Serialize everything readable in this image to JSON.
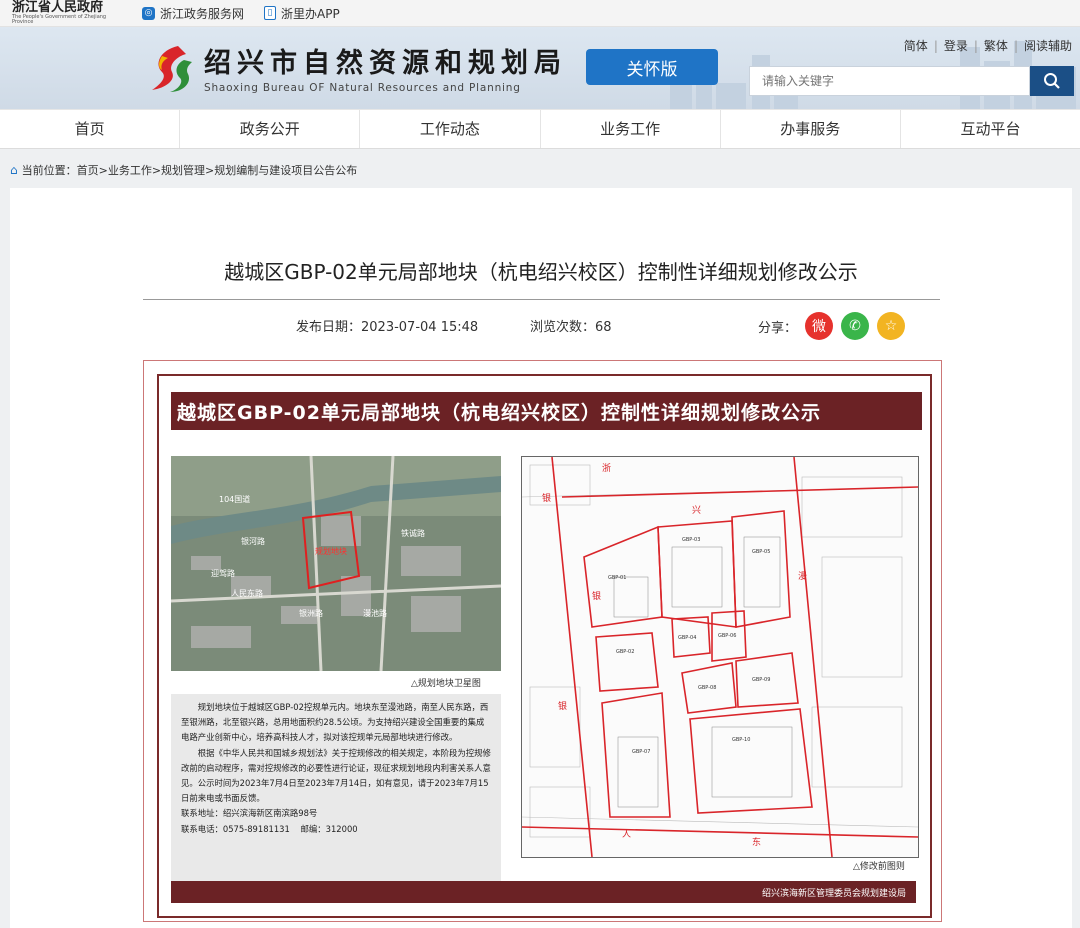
{
  "topbar": {
    "gov_name": "浙江省人民政府",
    "gov_name_en": "The People's Government of Zhejiang Province",
    "link1": "浙江政务服务网",
    "link2": "浙里办APP"
  },
  "header": {
    "site_title": "绍兴市自然资源和规划局",
    "site_title_en": "Shaoxing Bureau OF Natural Resources and Planning",
    "care_button": "关怀版",
    "tool_links": [
      "简体",
      "登录",
      "繁体",
      "阅读辅助"
    ],
    "search_placeholder": "请输入关键字"
  },
  "nav": [
    "首页",
    "政务公开",
    "工作动态",
    "业务工作",
    "办事服务",
    "互动平台"
  ],
  "breadcrumb": {
    "label": "当前位置：",
    "path": "首页>业务工作>规划管理>规划编制与建设项目公告公布"
  },
  "article": {
    "title": "越城区GBP-02单元局部地块（杭电绍兴校区）控制性详细规划修改公示",
    "publish_label": "发布日期：",
    "publish_date": "2023-07-04 15:48",
    "views_label": "浏览次数：",
    "views": "68",
    "share_label": "分享："
  },
  "poster": {
    "title": "越城区GBP-02单元局部地块（杭电绍兴校区）控制性详细规划修改公示",
    "sat_caption": "△规划地块卫星图",
    "map_caption": "△修改前图则",
    "sat_labels": {
      "road1": "104国道",
      "river": "银河路",
      "block": "规划地块",
      "road_e": "铁诚路",
      "road_w": "迎驾路",
      "road_s": "人民东路",
      "road_x": "银洲路",
      "road_y": "漫池路"
    },
    "desc1": "规划地块位于越城区GBP-02控规单元内。地块东至漫池路，南至人民东路，西至银洲路，北至银兴路，总用地面积约28.5公顷。为支持绍兴建设全国重要的集成电路产业创新中心，培养高科技人才，拟对该控规单元局部地块进行修改。",
    "desc2": "根据《中华人民共和国城乡规划法》关于控规修改的相关规定，本阶段为控规修改前的启动程序，需对控规修改的必要性进行论证，现征求规划地段内利害关系人意见。公示时间为2023年7月4日至2023年7月14日，如有意见，请于2023年7月15日前来电或书面反馈。",
    "contact_addr": "联系地址：绍兴滨海新区南滨路98号",
    "contact_phone": "联系电话：0575-89181131",
    "contact_zip": "邮编：312000",
    "footer": "绍兴滨海新区管理委员会规划建设局"
  },
  "colors": {
    "primary": "#1f74c6",
    "poster_red": "#6b2225",
    "search_btn": "#1b4f86"
  }
}
